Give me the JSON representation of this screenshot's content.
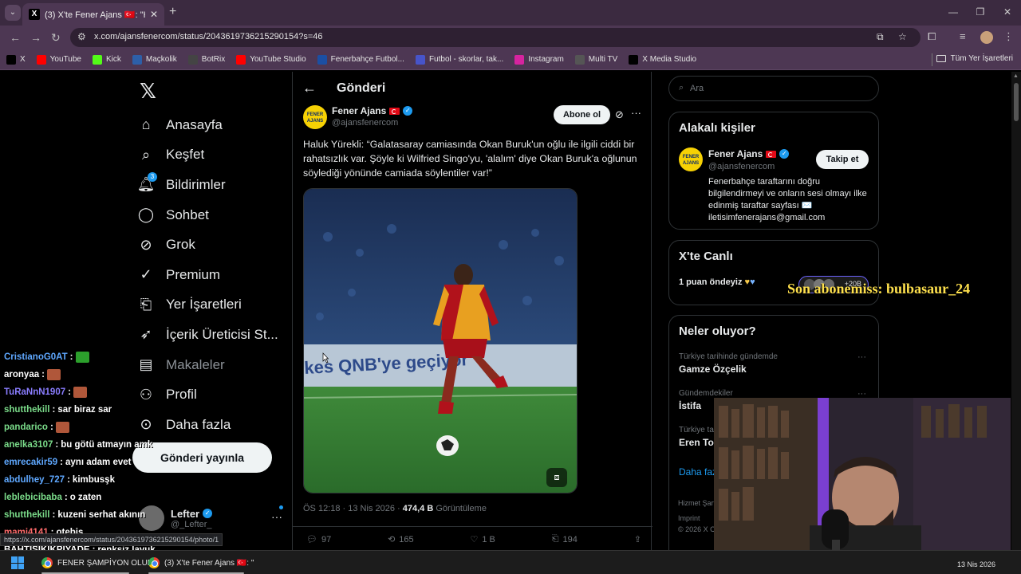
{
  "browser": {
    "tab_title": "(3) X'te Fener Ajans 🇹🇷: \"Haluk Y",
    "tab_close": "✕",
    "new_tab": "+",
    "url": "x.com/ajansfenercom/status/2043619736215290154?s=46",
    "bookmarks": [
      {
        "label": "X",
        "icon": "x-icon",
        "color": "#000000"
      },
      {
        "label": "YouTube",
        "icon": "youtube-icon",
        "color": "#ff0000"
      },
      {
        "label": "Kick",
        "icon": "kick-icon",
        "color": "#53fc18"
      },
      {
        "label": "Maçkolik",
        "icon": "mackolik-icon",
        "color": "#2d5fa8"
      },
      {
        "label": "BotRix",
        "icon": "botrix-icon",
        "color": "#444444"
      },
      {
        "label": "YouTube Studio",
        "icon": "youtube-studio-icon",
        "color": "#ff0000"
      },
      {
        "label": "Fenerbahçe Futbol...",
        "icon": "fenerbahce-icon",
        "color": "#1b4fa3"
      },
      {
        "label": "Futbol - skorlar, tak...",
        "icon": "flashscore-icon",
        "color": "#4754c9"
      },
      {
        "label": "Instagram",
        "icon": "instagram-icon",
        "color": "#d6249f"
      },
      {
        "label": "Multi TV",
        "icon": "multitv-icon",
        "color": "#555555"
      },
      {
        "label": "X Media Studio",
        "icon": "x-icon",
        "color": "#000000"
      }
    ],
    "all_bookmarks": "Tüm Yer İşaretleri"
  },
  "sidebar": {
    "items": [
      {
        "label": "Anasayfa",
        "icon": "home-icon"
      },
      {
        "label": "Keşfet",
        "icon": "search-icon"
      },
      {
        "label": "Bildirimler",
        "icon": "bell-icon",
        "badge": "3"
      },
      {
        "label": "Sohbet",
        "icon": "chat-icon"
      },
      {
        "label": "Grok",
        "icon": "grok-icon"
      },
      {
        "label": "Premium",
        "icon": "premium-icon"
      },
      {
        "label": "Yer İşaretleri",
        "icon": "bookmark-icon"
      },
      {
        "label": "İçerik Üreticisi St...",
        "icon": "rocket-icon"
      },
      {
        "label": "Makaleler",
        "icon": "article-icon"
      },
      {
        "label": "Profil",
        "icon": "person-icon"
      },
      {
        "label": "Daha fazla",
        "icon": "more-circle-icon"
      }
    ],
    "post_button": "Gönderi yayınla",
    "account": {
      "name": "Lefter",
      "handle": "@_Lefter_"
    }
  },
  "post": {
    "header_title": "Gönderi",
    "author_name": "Fener Ajans",
    "author_handle": "@ajansfenercom",
    "avatar_text": "FENER AJANS",
    "subscribe_label": "Abone ol",
    "text": "Haluk Yürekli: “Galatasaray camiasında Okan Buruk'un oğlu ile ilgili ciddi bir rahatsızlık var. Şöyle ki Wilfried Singo'yu, 'alalım' diye Okan Buruk'a oğlunun söylediği yönünde camiada söylentiler var!”",
    "time": "ÖS 12:18",
    "date": "13 Nis 2026",
    "views": "474,4 B",
    "views_label": "Görüntüleme",
    "replies": "97",
    "reposts": "165",
    "likes": "1 B",
    "bookmarks": "194"
  },
  "right": {
    "search_placeholder": "Ara",
    "related_title": "Alakalı kişiler",
    "related": {
      "name": "Fener Ajans",
      "handle": "@ajansfenercom",
      "follow_label": "Takip et",
      "bio": "Fenerbahçe taraftarını doğru bilgilendirmeyi ve onların sesi olmayı ilke edinmiş taraftar sayfası ✉️ iletisimfenerajans@gmail.com"
    },
    "live_title": "X'te Canlı",
    "live_text": "1 puan öndeyiz",
    "live_count": "+20B",
    "trends_title": "Neler oluyor?",
    "trends": [
      {
        "context": "Türkiye tarihinde gündemde",
        "title": "Gamze Özçelik"
      },
      {
        "context": "Gündemdekiler",
        "title": "İstifa"
      },
      {
        "context": "Türkiye ta",
        "title": "Eren Toz"
      }
    ],
    "show_more": "Daha faz",
    "footer1": "Hizmet Şart",
    "footer2": "Imprint",
    "footer3": "© 2026 X C"
  },
  "overlay": {
    "last_subscriber": "Son abonemiss: bulbasaur_24"
  },
  "chat": [
    {
      "user": "CristianoG0AT",
      "color": "#5fa8ff",
      "msg": "",
      "emote": "#2ca02c"
    },
    {
      "user": "aronyaa",
      "color": "#ffffff",
      "msg": "",
      "emote": "#b0573a"
    },
    {
      "user": "TuRaNnN1907",
      "color": "#8a7dff",
      "msg": "",
      "emote": "#b0573a"
    },
    {
      "user": "shutthekill",
      "color": "#7bdc8a",
      "msg": "sar biraz sar"
    },
    {
      "user": "pandarico",
      "color": "#7bdc8a",
      "msg": "",
      "emote": "#b0573a"
    },
    {
      "user": "anelka3107",
      "color": "#7bdc8a",
      "msg": "bu götü atmayın amk"
    },
    {
      "user": "emrecakir59",
      "color": "#5fa8ff",
      "msg": "aynı adam evet"
    },
    {
      "user": "abdulhey_727",
      "color": "#5fa8ff",
      "msg": "kimbusşk"
    },
    {
      "user": "leblebicibaba",
      "color": "#7bdc8a",
      "msg": "o zaten"
    },
    {
      "user": "shutthekill",
      "color": "#7bdc8a",
      "msg": "kuzeni serhat akının"
    },
    {
      "user": "mami4141",
      "color": "#ff6b6b",
      "msg": "otebis"
    },
    {
      "user": "BAHTISIKIKPIYADE",
      "color": "#ffffff",
      "msg": "renksiz lavuk"
    }
  ],
  "status_url": "https://x.com/ajansfenercom/status/2043619736215290154/photo/1",
  "taskbar": {
    "app1": "FENER ŞAMPİYON OLUR",
    "app2": "(3) X'te Fener Ajans 🇹🇷: \"",
    "date": "13 Nis 2026"
  }
}
